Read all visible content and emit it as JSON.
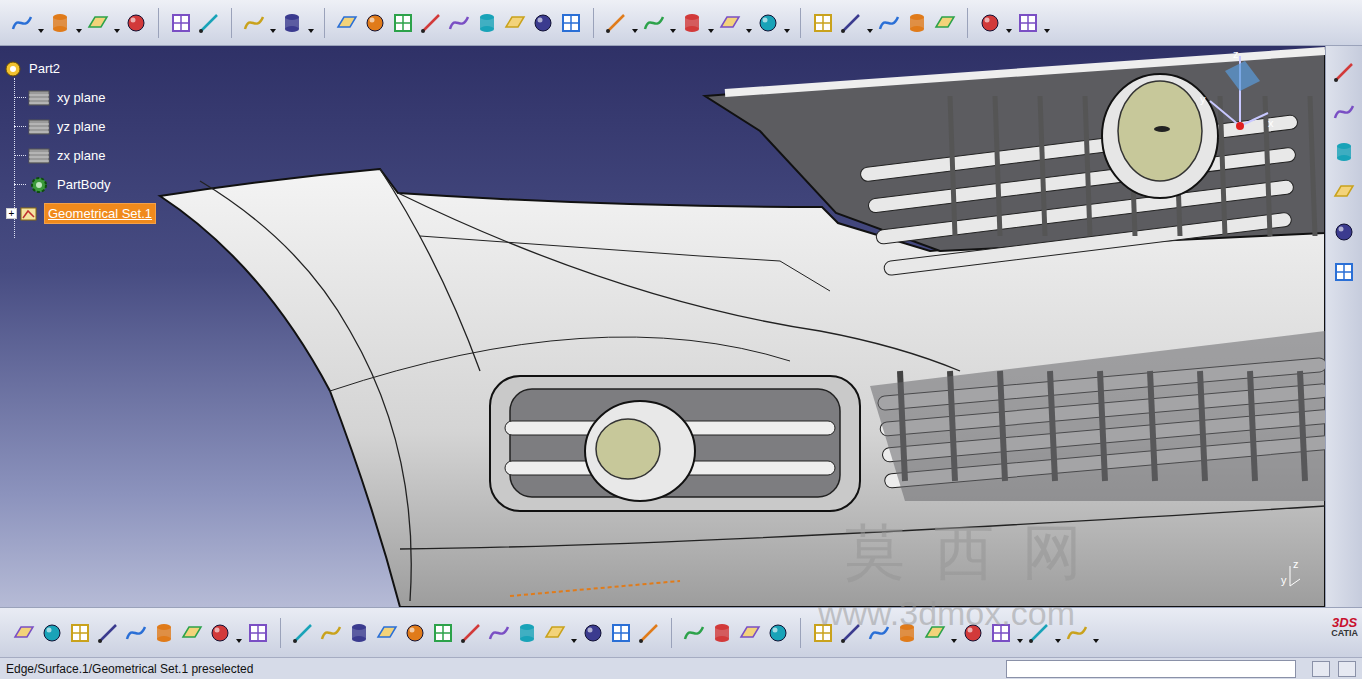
{
  "tree": {
    "root": "Part2",
    "items": [
      {
        "label": "xy plane",
        "kind": "plane",
        "selected": false,
        "expanded": false
      },
      {
        "label": "yz plane",
        "kind": "plane",
        "selected": false,
        "expanded": false
      },
      {
        "label": "zx plane",
        "kind": "plane",
        "selected": false,
        "expanded": false
      },
      {
        "label": "PartBody",
        "kind": "body",
        "selected": false,
        "expanded": false
      },
      {
        "label": "Geometrical Set.1",
        "kind": "set",
        "selected": true,
        "expanded": false
      }
    ]
  },
  "viewport": {
    "compass_axes": [
      "z",
      "y",
      "x"
    ],
    "mini_axes": [
      "z",
      "y"
    ]
  },
  "watermark": {
    "title": "莫 西 网",
    "url": "www.3dmox.com"
  },
  "logo": {
    "mark": "3DS",
    "name": "CATIA"
  },
  "status_bar": {
    "message": "Edge/Surface.1/Geometrical Set.1 preselected",
    "command": ""
  }
}
